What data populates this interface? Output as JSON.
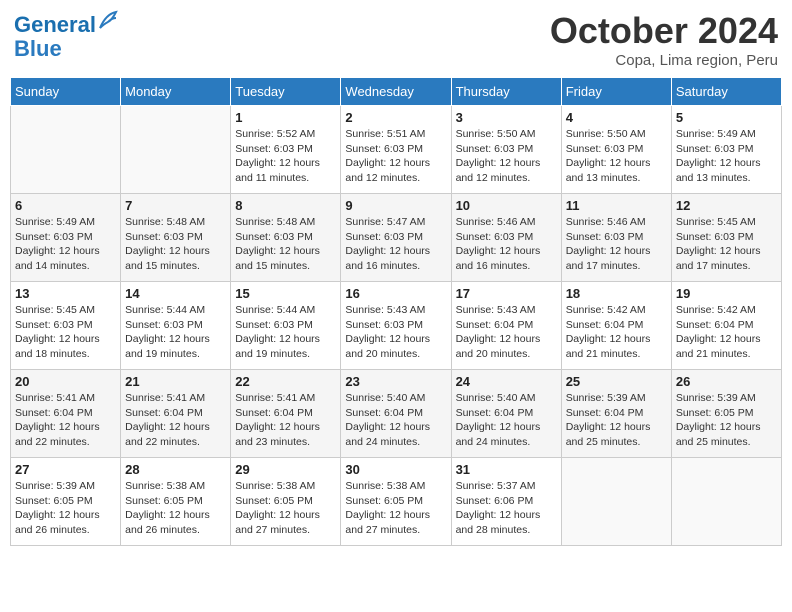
{
  "header": {
    "logo_line1": "General",
    "logo_line2": "Blue",
    "title": "October 2024",
    "subtitle": "Copa, Lima region, Peru"
  },
  "days_of_week": [
    "Sunday",
    "Monday",
    "Tuesday",
    "Wednesday",
    "Thursday",
    "Friday",
    "Saturday"
  ],
  "weeks": [
    [
      {
        "num": "",
        "detail": ""
      },
      {
        "num": "",
        "detail": ""
      },
      {
        "num": "1",
        "detail": "Sunrise: 5:52 AM\nSunset: 6:03 PM\nDaylight: 12 hours\nand 11 minutes."
      },
      {
        "num": "2",
        "detail": "Sunrise: 5:51 AM\nSunset: 6:03 PM\nDaylight: 12 hours\nand 12 minutes."
      },
      {
        "num": "3",
        "detail": "Sunrise: 5:50 AM\nSunset: 6:03 PM\nDaylight: 12 hours\nand 12 minutes."
      },
      {
        "num": "4",
        "detail": "Sunrise: 5:50 AM\nSunset: 6:03 PM\nDaylight: 12 hours\nand 13 minutes."
      },
      {
        "num": "5",
        "detail": "Sunrise: 5:49 AM\nSunset: 6:03 PM\nDaylight: 12 hours\nand 13 minutes."
      }
    ],
    [
      {
        "num": "6",
        "detail": "Sunrise: 5:49 AM\nSunset: 6:03 PM\nDaylight: 12 hours\nand 14 minutes."
      },
      {
        "num": "7",
        "detail": "Sunrise: 5:48 AM\nSunset: 6:03 PM\nDaylight: 12 hours\nand 15 minutes."
      },
      {
        "num": "8",
        "detail": "Sunrise: 5:48 AM\nSunset: 6:03 PM\nDaylight: 12 hours\nand 15 minutes."
      },
      {
        "num": "9",
        "detail": "Sunrise: 5:47 AM\nSunset: 6:03 PM\nDaylight: 12 hours\nand 16 minutes."
      },
      {
        "num": "10",
        "detail": "Sunrise: 5:46 AM\nSunset: 6:03 PM\nDaylight: 12 hours\nand 16 minutes."
      },
      {
        "num": "11",
        "detail": "Sunrise: 5:46 AM\nSunset: 6:03 PM\nDaylight: 12 hours\nand 17 minutes."
      },
      {
        "num": "12",
        "detail": "Sunrise: 5:45 AM\nSunset: 6:03 PM\nDaylight: 12 hours\nand 17 minutes."
      }
    ],
    [
      {
        "num": "13",
        "detail": "Sunrise: 5:45 AM\nSunset: 6:03 PM\nDaylight: 12 hours\nand 18 minutes."
      },
      {
        "num": "14",
        "detail": "Sunrise: 5:44 AM\nSunset: 6:03 PM\nDaylight: 12 hours\nand 19 minutes."
      },
      {
        "num": "15",
        "detail": "Sunrise: 5:44 AM\nSunset: 6:03 PM\nDaylight: 12 hours\nand 19 minutes."
      },
      {
        "num": "16",
        "detail": "Sunrise: 5:43 AM\nSunset: 6:03 PM\nDaylight: 12 hours\nand 20 minutes."
      },
      {
        "num": "17",
        "detail": "Sunrise: 5:43 AM\nSunset: 6:04 PM\nDaylight: 12 hours\nand 20 minutes."
      },
      {
        "num": "18",
        "detail": "Sunrise: 5:42 AM\nSunset: 6:04 PM\nDaylight: 12 hours\nand 21 minutes."
      },
      {
        "num": "19",
        "detail": "Sunrise: 5:42 AM\nSunset: 6:04 PM\nDaylight: 12 hours\nand 21 minutes."
      }
    ],
    [
      {
        "num": "20",
        "detail": "Sunrise: 5:41 AM\nSunset: 6:04 PM\nDaylight: 12 hours\nand 22 minutes."
      },
      {
        "num": "21",
        "detail": "Sunrise: 5:41 AM\nSunset: 6:04 PM\nDaylight: 12 hours\nand 22 minutes."
      },
      {
        "num": "22",
        "detail": "Sunrise: 5:41 AM\nSunset: 6:04 PM\nDaylight: 12 hours\nand 23 minutes."
      },
      {
        "num": "23",
        "detail": "Sunrise: 5:40 AM\nSunset: 6:04 PM\nDaylight: 12 hours\nand 24 minutes."
      },
      {
        "num": "24",
        "detail": "Sunrise: 5:40 AM\nSunset: 6:04 PM\nDaylight: 12 hours\nand 24 minutes."
      },
      {
        "num": "25",
        "detail": "Sunrise: 5:39 AM\nSunset: 6:04 PM\nDaylight: 12 hours\nand 25 minutes."
      },
      {
        "num": "26",
        "detail": "Sunrise: 5:39 AM\nSunset: 6:05 PM\nDaylight: 12 hours\nand 25 minutes."
      }
    ],
    [
      {
        "num": "27",
        "detail": "Sunrise: 5:39 AM\nSunset: 6:05 PM\nDaylight: 12 hours\nand 26 minutes."
      },
      {
        "num": "28",
        "detail": "Sunrise: 5:38 AM\nSunset: 6:05 PM\nDaylight: 12 hours\nand 26 minutes."
      },
      {
        "num": "29",
        "detail": "Sunrise: 5:38 AM\nSunset: 6:05 PM\nDaylight: 12 hours\nand 27 minutes."
      },
      {
        "num": "30",
        "detail": "Sunrise: 5:38 AM\nSunset: 6:05 PM\nDaylight: 12 hours\nand 27 minutes."
      },
      {
        "num": "31",
        "detail": "Sunrise: 5:37 AM\nSunset: 6:06 PM\nDaylight: 12 hours\nand 28 minutes."
      },
      {
        "num": "",
        "detail": ""
      },
      {
        "num": "",
        "detail": ""
      }
    ]
  ]
}
